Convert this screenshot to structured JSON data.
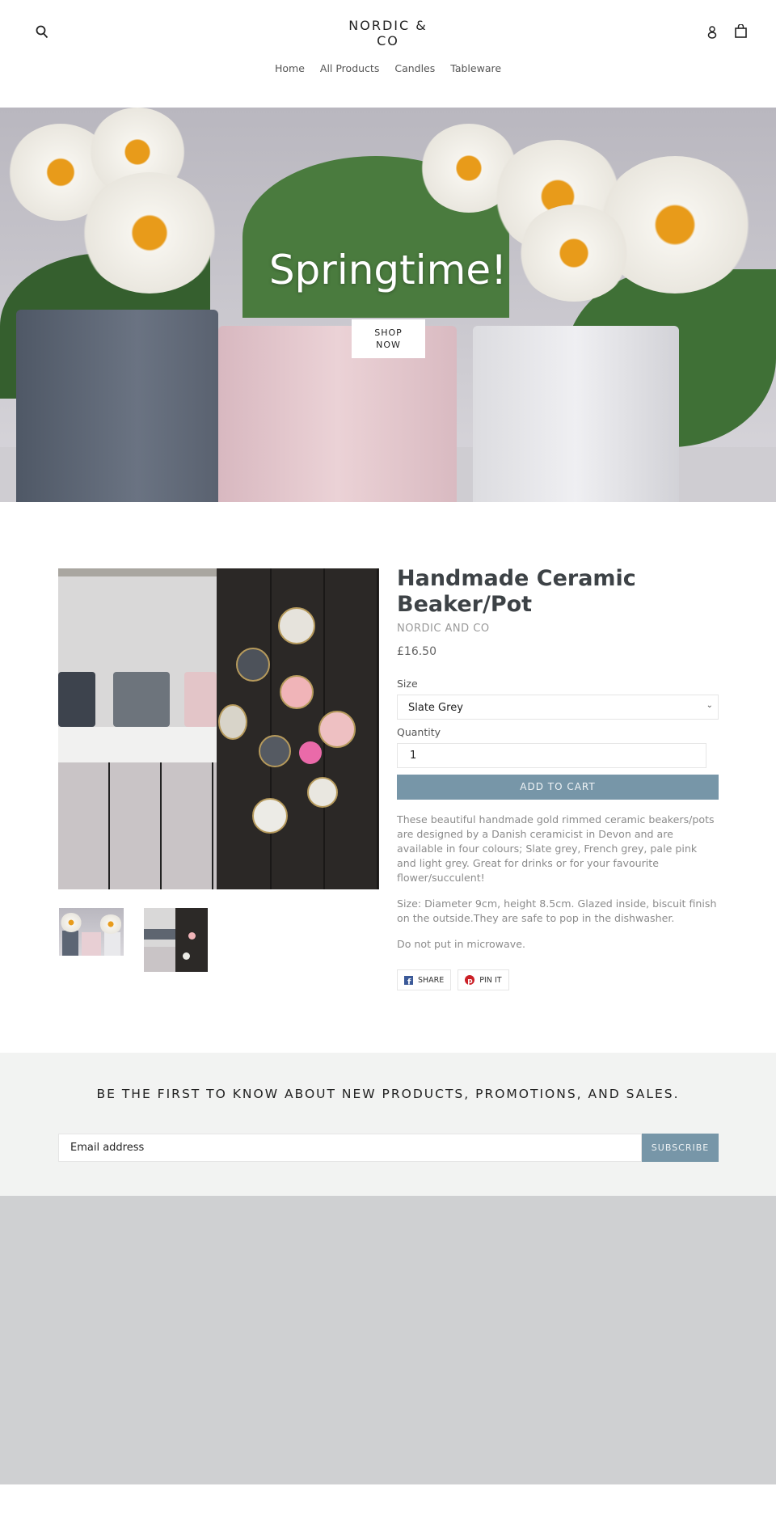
{
  "header": {
    "logo_line1": "NORDIC &",
    "logo_line2": "CO",
    "nav": [
      "Home",
      "All Products",
      "Candles",
      "Tableware"
    ]
  },
  "hero": {
    "title": "Springtime!",
    "button_line1": "SHOP",
    "button_line2": "NOW"
  },
  "product": {
    "title": "Handmade Ceramic Beaker/Pot",
    "vendor": "NORDIC AND CO",
    "price": "£16.50",
    "size_label": "Size",
    "size_value": "Slate Grey",
    "quantity_label": "Quantity",
    "quantity_value": "1",
    "add_to_cart": "ADD TO CART",
    "description": [
      "These beautiful handmade gold rimmed ceramic beakers/pots are designed by a Danish ceramicist in Devon and are available in four colours; Slate grey, French grey, pale pink and light grey. Great for drinks or for your favourite flower/succulent!",
      "Size: Diameter 9cm, height 8.5cm. Glazed inside, biscuit finish on the outside.They are safe to pop in the dishwasher.",
      "Do not put in microwave."
    ],
    "share": "SHARE",
    "pin": "PIN IT"
  },
  "newsletter": {
    "heading": "BE THE FIRST TO KNOW ABOUT NEW PRODUCTS, PROMOTIONS, AND SALES.",
    "placeholder": "Email address",
    "button": "SUBSCRIBE"
  },
  "colors": {
    "accent": "#7796a8",
    "newsletter_bg": "#f2f3f2",
    "footer_bg": "#cfd0d2"
  }
}
